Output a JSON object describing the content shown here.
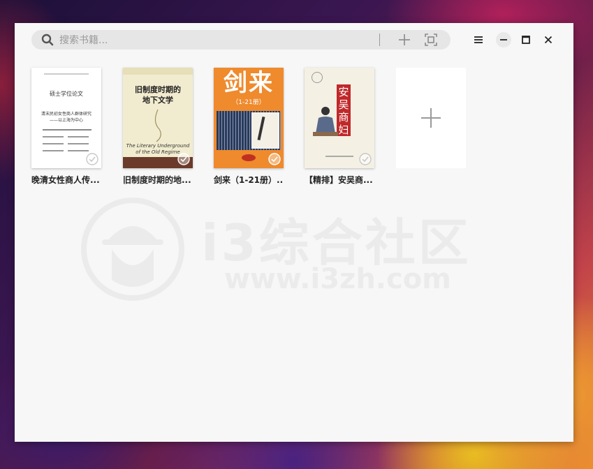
{
  "search": {
    "placeholder": "搜索书籍..."
  },
  "toolbar": {
    "add_icon": "plus-icon",
    "scan_icon": "scan-icon",
    "menu_icon": "hamburger-menu-icon",
    "minimize_icon": "minimize-icon",
    "maximize_icon": "maximize-icon",
    "close_icon": "close-icon"
  },
  "books": [
    {
      "title": "晚清女性商人传...",
      "cover_lines": [
        "硕士学位论文",
        "清末民初女性商人群体研究",
        "——以上海为中心"
      ],
      "selected": true
    },
    {
      "title": "旧制度时期的地...",
      "cover_title": "旧制度时期的地下文学",
      "cover_subtitle": "The Literary Underground of the Old Regime",
      "selected": true
    },
    {
      "title": "剑来（1-21册）...",
      "cover_title": "剑来",
      "cover_subtitle": "（1-21册）",
      "selected": true
    },
    {
      "title": "【精排】安吴商...",
      "cover_title": "安吴商妇",
      "selected": true
    }
  ],
  "add_book_tile": {
    "icon": "plus-icon"
  },
  "watermark": {
    "brand": "i3综合社区",
    "url": "www.i3zh.com"
  },
  "colors": {
    "window_bg": "#f7f7f7",
    "search_bg": "#e6e6e6",
    "accent_orange": "#ef8a2d"
  }
}
